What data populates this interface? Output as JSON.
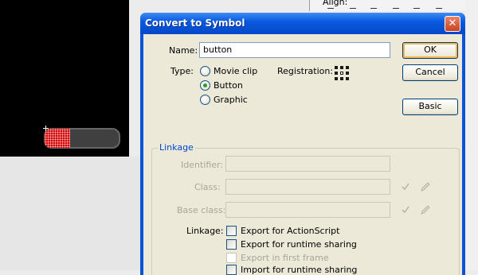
{
  "background": {
    "align_label": "Align:"
  },
  "dialog": {
    "title": "Convert to Symbol",
    "close_glyph": "✕",
    "name_label": "Name:",
    "name_value": "button",
    "type_label": "Type:",
    "type_options": [
      {
        "label": "Movie clip",
        "checked": false
      },
      {
        "label": "Button",
        "checked": true
      },
      {
        "label": "Graphic",
        "checked": false
      }
    ],
    "registration_label": "Registration:",
    "buttons": {
      "ok": "OK",
      "cancel": "Cancel",
      "basic": "Basic"
    },
    "linkage": {
      "section_title": "Linkage",
      "identifier_label": "Identifier:",
      "class_label": "Class:",
      "base_class_label": "Base class:",
      "linkage_label": "Linkage:",
      "options": [
        {
          "label": "Export for ActionScript",
          "enabled": true,
          "checked": false
        },
        {
          "label": "Export for runtime sharing",
          "enabled": true,
          "checked": false
        },
        {
          "label": "Export in first frame",
          "enabled": false,
          "checked": false
        },
        {
          "label": "Import for runtime sharing",
          "enabled": true,
          "checked": false
        }
      ]
    }
  },
  "colors": {
    "titlebar": "#0a5be0",
    "dialog_face": "#ece9d8",
    "progress_fill": "#d40000"
  },
  "icons": [
    "close-icon",
    "registration-grid-icon",
    "checkmark-icon",
    "pencil-icon",
    "crosshair-icon"
  ]
}
